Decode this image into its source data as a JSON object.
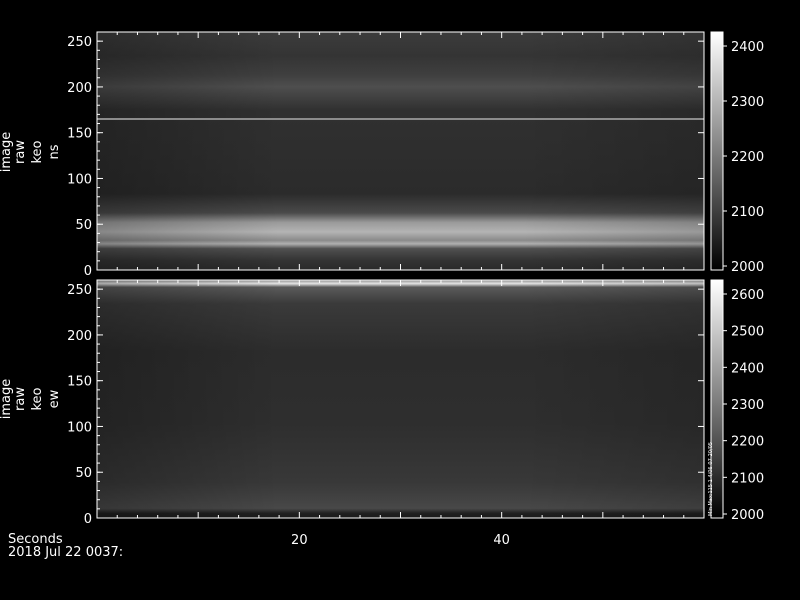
{
  "chart_data": [
    {
      "type": "heatmap",
      "ylabel": [
        "image",
        "raw",
        "keo",
        "ns"
      ],
      "ylim": [
        0,
        260
      ],
      "yticks": [
        0,
        50,
        100,
        150,
        200,
        250
      ],
      "colorbar": {
        "range": [
          2000,
          2430
        ],
        "ticks": [
          2000,
          2100,
          2200,
          2300,
          2400
        ]
      },
      "features": [
        {
          "y_from": 28,
          "y_to": 54,
          "level": 2300
        },
        {
          "y_from": 185,
          "y_to": 205,
          "level": 2170
        },
        {
          "y": 162,
          "level": 2280
        }
      ]
    },
    {
      "type": "heatmap",
      "ylabel": [
        "image",
        "raw",
        "keo",
        "ew"
      ],
      "ylim": [
        0,
        260
      ],
      "yticks": [
        0,
        50,
        100,
        150,
        200,
        250
      ],
      "colorbar": {
        "range": [
          2000,
          2620
        ],
        "ticks": [
          2000,
          2100,
          2200,
          2300,
          2400,
          2500,
          2600
        ]
      },
      "colorbar_note": "Min Max:115 1 4/06-07-20/05",
      "features": [
        {
          "y": 251,
          "level": 2550
        },
        {
          "y_from": 0,
          "y_to": 4,
          "level": 2000
        }
      ]
    }
  ],
  "x_axis": {
    "label": "Seconds",
    "ticks": [
      20,
      40
    ],
    "xlim": [
      0,
      60
    ],
    "date": "2018 Jul 22 0037:"
  },
  "colors": {
    "background": "#000000",
    "text": "#ffffff"
  }
}
